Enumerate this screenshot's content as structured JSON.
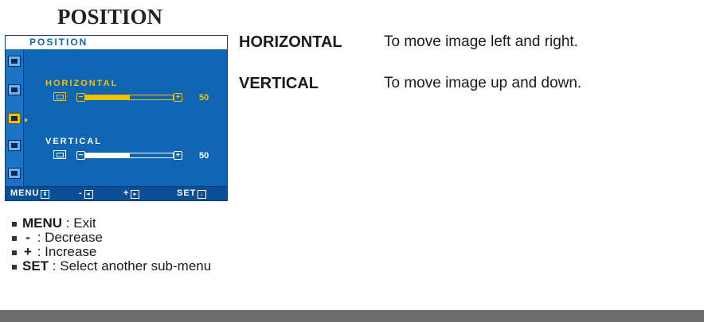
{
  "page": {
    "title": "POSITION"
  },
  "osd": {
    "header": "POSITION",
    "horizontal": {
      "label": "HORIZONTAL",
      "value": "50",
      "level": 0.5,
      "minus": "−",
      "plus": "+"
    },
    "vertical": {
      "label": "VERTICAL",
      "value": "50",
      "level": 0.5,
      "minus": "−",
      "plus": "+"
    },
    "footer": {
      "menu": "MENU",
      "minus": "-",
      "plus": "+",
      "set": "SET"
    },
    "colors": {
      "background": "#0f65b3",
      "accent": "#f2c200",
      "text": "#ffffff"
    }
  },
  "descriptions": [
    {
      "term": "HORIZONTAL",
      "text": "To move image left and right."
    },
    {
      "term": "VERTICAL",
      "text": "To move image up and down."
    }
  ],
  "legend": [
    {
      "key": "MENU",
      "text": ": Exit"
    },
    {
      "key": "-",
      "text": ": Decrease"
    },
    {
      "key": "+",
      "text": ": Increase"
    },
    {
      "key": "SET",
      "text": ": Select another sub-menu"
    }
  ]
}
